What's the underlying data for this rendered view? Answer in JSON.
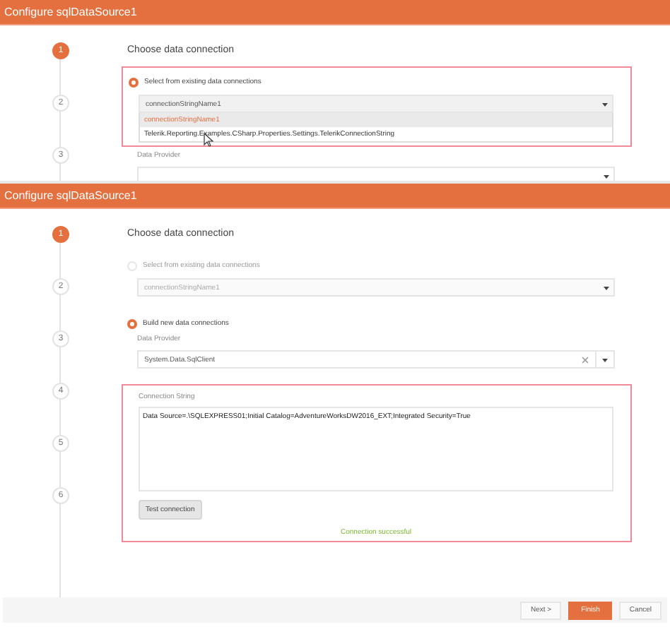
{
  "dialogs": [
    {
      "title": "Configure sqlDataSource1",
      "steps": [
        {
          "number": "1",
          "selected": true
        },
        {
          "number": "2",
          "selected": false
        },
        {
          "number": "3",
          "selected": false
        }
      ],
      "heading": "Choose data connection",
      "blocks": [
        {
          "kind": "highlight",
          "children": [
            {
              "kind": "radio",
              "label": "Select from existing data connections",
              "selected": true,
              "disabled": false
            },
            {
              "kind": "select",
              "value": "connectionStringName1",
              "disabled": false,
              "open": true,
              "options": [
                {
                  "label": "connectionStringName1",
                  "selected": true
                },
                {
                  "label": "Telerik.Reporting.Examples.CSharp.Properties.Settings.TelerikConnectionString",
                  "selected": false
                }
              ]
            }
          ]
        },
        {
          "kind": "caption",
          "text": "Data Provider"
        },
        {
          "kind": "select",
          "open": false
        }
      ]
    },
    {
      "title": "Configure sqlDataSource1",
      "steps": [
        {
          "number": "1",
          "selected": true
        },
        {
          "number": "2",
          "selected": false
        },
        {
          "number": "3",
          "selected": false
        },
        {
          "number": "4",
          "selected": false
        },
        {
          "number": "5",
          "selected": false
        },
        {
          "number": "6",
          "selected": false
        }
      ],
      "heading": "Choose data connection",
      "blocks": [
        {
          "kind": "radio",
          "label": "Select from existing data connections",
          "selected": false,
          "disabled": true
        },
        {
          "kind": "select",
          "value": "connectionStringName1",
          "disabled": true,
          "open": false
        },
        {
          "kind": "radio",
          "label": "Build new data connections",
          "selected": true,
          "disabled": false
        },
        {
          "kind": "caption",
          "text": "Data Provider"
        },
        {
          "kind": "select",
          "value": "System.Data.SqlClient",
          "disabled": false,
          "open": false,
          "clearable": true
        },
        {
          "kind": "highlight",
          "children": [
            {
              "kind": "caption",
              "text": "Connection String"
            },
            {
              "kind": "textarea",
              "value": "Data Source=.\\SQLEXPRESS01;Initial Catalog=AdventureWorksDW2016_EXT;Integrated Security=True"
            },
            {
              "kind": "button",
              "label": "Test connection"
            },
            {
              "kind": "message",
              "text": "Connection successful"
            }
          ]
        }
      ],
      "footer": [
        {
          "label": "Next >",
          "kind": "plain"
        },
        {
          "label": "Finish",
          "kind": "primary"
        },
        {
          "label": "Cancel",
          "kind": "plain"
        }
      ]
    }
  ]
}
